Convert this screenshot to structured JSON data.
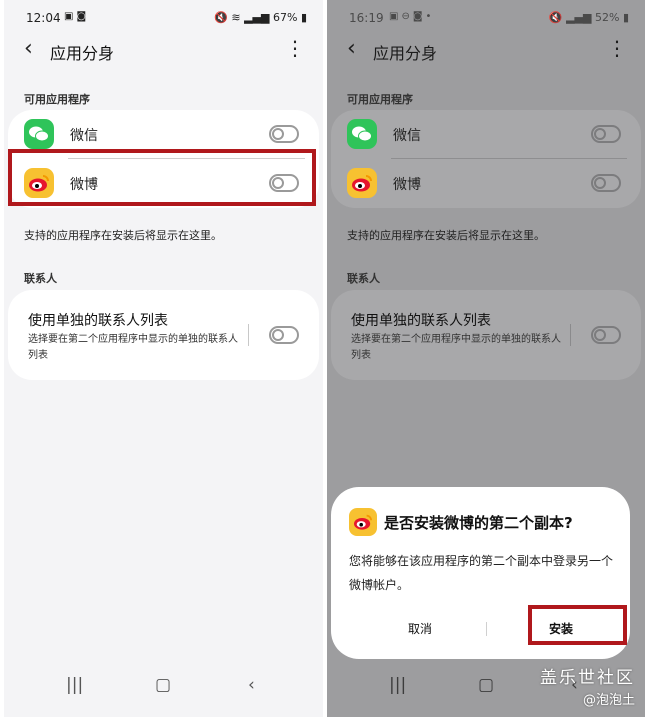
{
  "left": {
    "status": {
      "time": "12:04",
      "notif_icons": [
        "image-icon",
        "app-icon"
      ],
      "battery": "67%"
    },
    "appbar": {
      "title": "应用分身"
    },
    "available_section": "可用应用程序",
    "apps": [
      {
        "name": "微信",
        "icon": "wechat-icon",
        "enabled": false
      },
      {
        "name": "微博",
        "icon": "weibo-icon",
        "enabled": false
      }
    ],
    "hint": "支持的应用程序在安装后将显示在这里。",
    "contacts_section": "联系人",
    "contacts": {
      "title": "使用单独的联系人列表",
      "subtitle": "选择要在第二个应用程序中显示的单独的联系人列表",
      "enabled": false
    }
  },
  "right": {
    "status": {
      "time": "16:19",
      "battery": "52%"
    },
    "appbar": {
      "title": "应用分身"
    },
    "available_section": "可用应用程序",
    "apps": [
      {
        "name": "微信",
        "icon": "wechat-icon",
        "enabled": false
      },
      {
        "name": "微博",
        "icon": "weibo-icon",
        "enabled": false
      }
    ],
    "hint": "支持的应用程序在安装后将显示在这里。",
    "contacts_section": "联系人",
    "contacts": {
      "title": "使用单独的联系人列表",
      "subtitle": "选择要在第二个应用程序中显示的单独的联系人列表",
      "enabled": false
    },
    "dialog": {
      "title": "是否安装微博的第二个副本?",
      "body": "您将能够在该应用程序的第二个副本中登录另一个微博帐户。",
      "cancel": "取消",
      "install": "安装"
    }
  },
  "watermark": {
    "main": "盖乐世社区",
    "sub": "@泡泡土"
  },
  "colors": {
    "wechat": "#2fc45a",
    "weibo": "#f7c131",
    "highlight": "#b0181c"
  }
}
